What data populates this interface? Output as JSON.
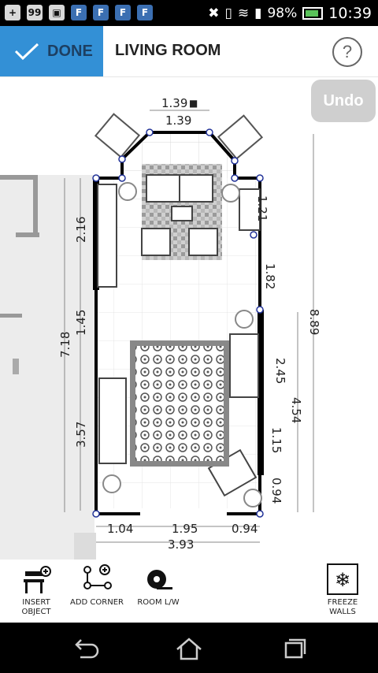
{
  "status": {
    "battery": "98%",
    "time": "10:39"
  },
  "toolbar": {
    "done": "DONE",
    "title": "LIVING ROOM",
    "help": "?"
  },
  "undo": "Undo",
  "plan": {
    "dims": {
      "top1": "1.39",
      "top2": "1.39",
      "left1": "2.16",
      "left2": "1.45",
      "left3": "3.57",
      "leftTotal": "7.18",
      "right1": "1.21",
      "right2": "1.82",
      "right3": "2.45",
      "right4": "1.15",
      "right5": "0.94",
      "right6": "4.54",
      "rightTotal": "8.89",
      "bot1": "1.04",
      "bot2": "1.95",
      "bot3": "0.94",
      "botTotal": "3.93"
    }
  },
  "tools": {
    "insert1": "INSERT",
    "insert2": "OBJECT",
    "corner": "ADD CORNER",
    "roomlw": "ROOM L/W",
    "freeze1": "FREEZE",
    "freeze2": "WALLS"
  }
}
